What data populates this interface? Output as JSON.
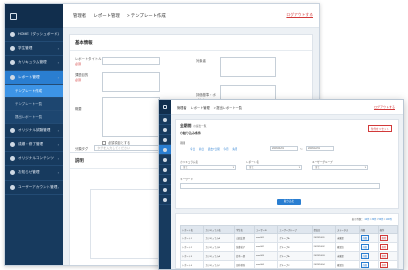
{
  "back": {
    "header": {
      "breadcrumb": [
        "管理者",
        "レポート管理",
        "> テンプレート作成"
      ],
      "logout": "ログアウトする"
    },
    "sidebar": {
      "items": [
        {
          "label": "HOME（ダッシュボード）"
        },
        {
          "label": "学生管理"
        },
        {
          "label": "カリキュラム管理"
        },
        {
          "label": "レポート管理",
          "active": true
        },
        {
          "label": "テンプレート作成",
          "sub": true,
          "active": true
        },
        {
          "label": "テンプレート一覧",
          "sub": true
        },
        {
          "label": "提出レポート一覧",
          "sub": true
        },
        {
          "label": "オリジナル試験管理"
        },
        {
          "label": "成績・修了管理"
        },
        {
          "label": "オリジナルコンテンツ"
        },
        {
          "label": "お知らせ管理"
        },
        {
          "label": "ユーザーアカウント管理"
        }
      ]
    },
    "main": {
      "section_title": "基本情報",
      "labels": {
        "report_title": "レポートタイトル",
        "title_required": "必須",
        "purpose": "課題目的",
        "purpose_required": "必須",
        "summary": "概要",
        "submitter": "対象者",
        "assessment": "評価基準・ポイント",
        "tag": "分類タグ"
      },
      "checkbox_label": "必須項目とする",
      "tag_placeholder": "タグを入力してください",
      "section2_title": "説明"
    }
  },
  "front": {
    "header": {
      "breadcrumb": [
        "管理者",
        "レポート管理",
        "> 提出レポート一覧"
      ],
      "logout": "ログアウトする"
    },
    "panel": {
      "title": "全期間",
      "title_small": "の提出一覧",
      "subtitle": "⊙絞り込み条件",
      "reset": "条件をリセット",
      "period_label": "期間",
      "period_links": [
        "今日",
        "前日",
        "過去7日間",
        "今月",
        "先月"
      ],
      "date_from": "2023/01/01",
      "date_to": "2023/12/31",
      "curriculum_label": "カリキュラム名",
      "curriculum_value": "全て",
      "report_label": "レポート名",
      "report_value": "全て",
      "group_label": "ユーザーグループ",
      "group_value": "全て",
      "keyword_label": "キーワード",
      "search_button": "絞り込む"
    },
    "results": {
      "count_text": "表示件数：",
      "count_links": [
        "10件",
        "30件",
        "50件",
        "100件"
      ],
      "columns": [
        "レポート名",
        "カリキュラム名",
        "学生名",
        "ユーザーID",
        "ユーザーグループ",
        "提出日",
        "ステータス",
        "詳細",
        "操作"
      ],
      "rows": [
        [
          "レポート1",
          "カリキュラムA",
          "山田太郎",
          "user001",
          "グループA",
          "2023/10/01",
          "未確認",
          "詳細",
          "削除"
        ],
        [
          "レポート2",
          "カリキュラムB",
          "佐藤花子",
          "user002",
          "グループB",
          "2023/10/02",
          "確認済",
          "詳細",
          "削除"
        ],
        [
          "レポート3",
          "カリキュラムA",
          "鈴木一郎",
          "user003",
          "グループA",
          "2023/10/03",
          "未確認",
          "詳細",
          "削除"
        ],
        [
          "レポート4",
          "カリキュラムC",
          "田中美咲",
          "user004",
          "グループC",
          "2023/10/04",
          "確認済",
          "詳細",
          "削除"
        ],
        [
          "レポート5",
          "カリキュラムB",
          "高橋健",
          "user005",
          "グループB",
          "2023/10/05",
          "未確認",
          "詳細",
          "削除"
        ]
      ]
    }
  }
}
